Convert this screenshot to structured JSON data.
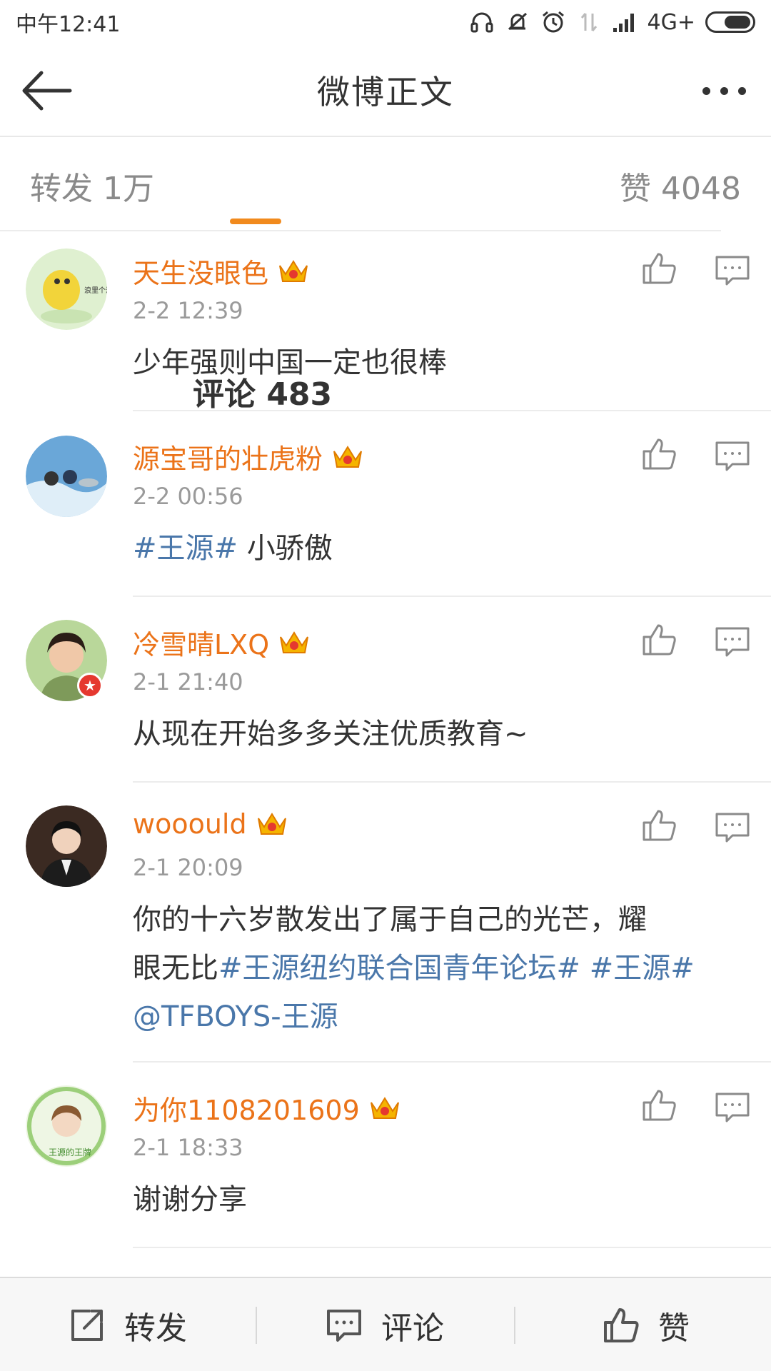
{
  "status_bar": {
    "time": "中午12:41",
    "network": "4G+",
    "icons": [
      "headphones-icon",
      "mute-icon",
      "alarm-icon",
      "signal-icon",
      "battery-icon"
    ]
  },
  "header": {
    "title": "微博正文",
    "back_icon": "back-arrow-icon",
    "more_icon": "more-dots-icon"
  },
  "tabs": {
    "repost": "转发 1万",
    "comments": "评论 483",
    "likes": "赞 4048",
    "active": "comments",
    "accent_color": "#f18a1d"
  },
  "comments": [
    {
      "username": "天生没眼色",
      "time": "2-2 12:39",
      "text": "少年强则中国一定也很棒",
      "avatar_label": "浪里个浪"
    },
    {
      "username": "源宝哥的壮虎粉",
      "time": "2-2 00:56",
      "text_tag": "#王源#",
      "text": " 小骄傲"
    },
    {
      "username": "冷雪晴LXQ",
      "time": "2-1 21:40",
      "text": "从现在开始多多关注优质教育~"
    },
    {
      "username": "wooould",
      "time": "2-1 20:09",
      "text_line1": "你的十六岁散发出了属于自己的光芒，耀",
      "text_line2_plain": "眼无比",
      "text_line2_tag1": "#王源纽约联合国青年论坛#",
      "text_line2_tag2": " #王源#",
      "text_line3_mention": "@TFBOYS-王源"
    },
    {
      "username": "为你1108201609",
      "time": "2-1 18:33",
      "text": "谢谢分享",
      "avatar_label": "王源的王牌"
    }
  ],
  "bottom_bar": {
    "repost": "转发",
    "comment": "评论",
    "like": "赞"
  },
  "colors": {
    "username": "#eb7319",
    "tag": "#4a77aa",
    "timestamp": "#9a9a9a"
  }
}
